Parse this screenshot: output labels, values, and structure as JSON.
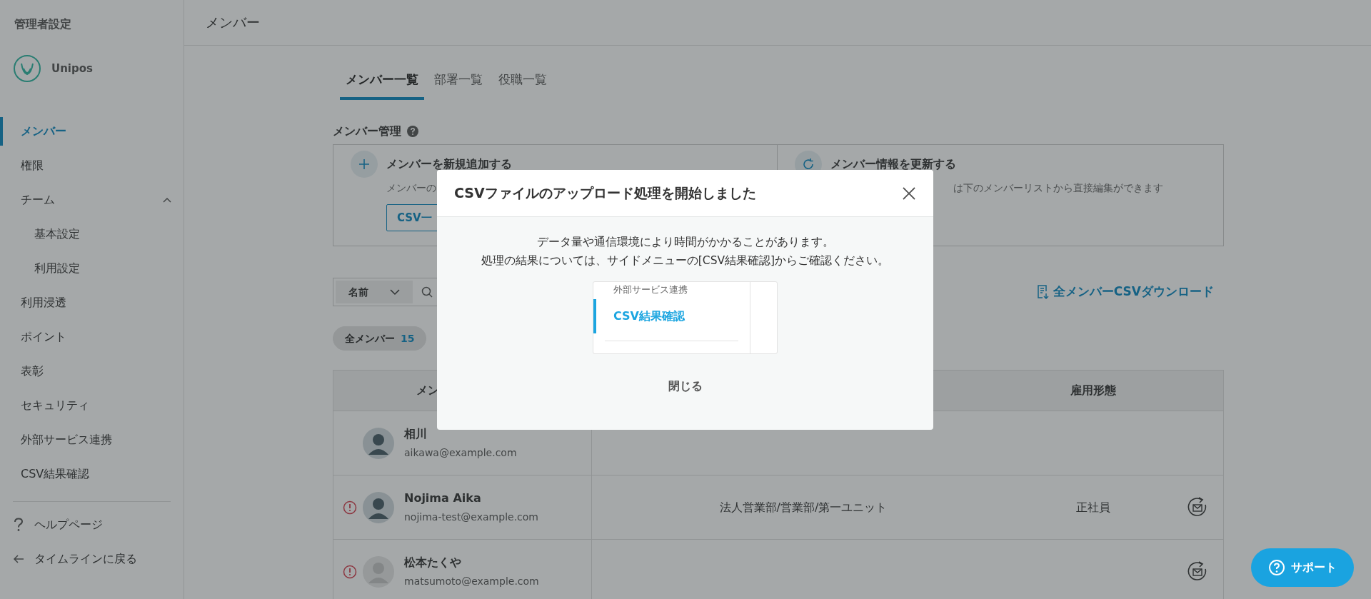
{
  "sidebar": {
    "title": "管理者設定",
    "brand": "Unipos",
    "items": [
      {
        "label": "メンバー",
        "selected": true
      },
      {
        "label": "権限",
        "selected": false
      },
      {
        "label": "チーム",
        "selected": false,
        "expanded": true,
        "children": [
          {
            "label": "基本設定",
            "selected": false
          },
          {
            "label": "利用設定",
            "selected": false
          }
        ]
      },
      {
        "label": "利用浸透",
        "selected": false
      },
      {
        "label": "ポイント",
        "selected": false
      },
      {
        "label": "表彰",
        "selected": false
      },
      {
        "label": "セキュリティ",
        "selected": false
      },
      {
        "label": "外部サービス連携",
        "selected": false
      },
      {
        "label": "CSV結果確認",
        "selected": false
      }
    ],
    "links": [
      {
        "kind": "help",
        "label": "ヘルプページ"
      },
      {
        "kind": "back",
        "label": "タイムラインに戻る"
      }
    ]
  },
  "header": {
    "title": "メンバー"
  },
  "tabs": [
    {
      "label": "メンバー一覧",
      "selected": true
    },
    {
      "label": "部署一覧",
      "selected": false
    },
    {
      "label": "役職一覧",
      "selected": false
    }
  ],
  "section": {
    "title": "メンバー管理"
  },
  "cards": [
    {
      "kind": "add",
      "title": "メンバーを新規追加する",
      "text": "メンバーの",
      "button": "CSV一"
    },
    {
      "kind": "update",
      "title": "メンバー情報を更新する",
      "text": "は下のメンバーリストから直接編集ができます"
    }
  ],
  "search": {
    "field": "名前"
  },
  "download": {
    "label": "全メンバーCSVダウンロード"
  },
  "filters": [
    {
      "label": "全メンバー",
      "count": "15",
      "selected": true
    }
  ],
  "table": {
    "columns": [
      {
        "label": "メン"
      },
      {
        "label": "雇用形態"
      }
    ],
    "rows": [
      {
        "name": "相川",
        "email": "aikawa@example.com",
        "has_photo": true,
        "warning": false,
        "resend": false
      },
      {
        "name": "Nojima Aika",
        "email": "nojima-test@example.com",
        "has_photo": true,
        "warning": true,
        "department": "法人営業部/営業部/第一ユニット",
        "employment": "正社員",
        "resend": true
      },
      {
        "name": "松本たくや",
        "email": "matsumoto@example.com",
        "has_photo": false,
        "warning": true,
        "resend": true
      }
    ]
  },
  "modal": {
    "title": "CSVファイルのアップロード処理を開始しました",
    "lines": [
      "データ量や通信環境により時間がかかることがあります。",
      "処理の結果については、サイドメニューの[CSV結果確認]からご確認ください。"
    ],
    "preview": [
      {
        "label": "外部サービス連携",
        "selected": false
      },
      {
        "label": "CSV結果確認",
        "selected": true
      }
    ],
    "close_button": "閉じる"
  },
  "support": {
    "label": "サポート"
  }
}
